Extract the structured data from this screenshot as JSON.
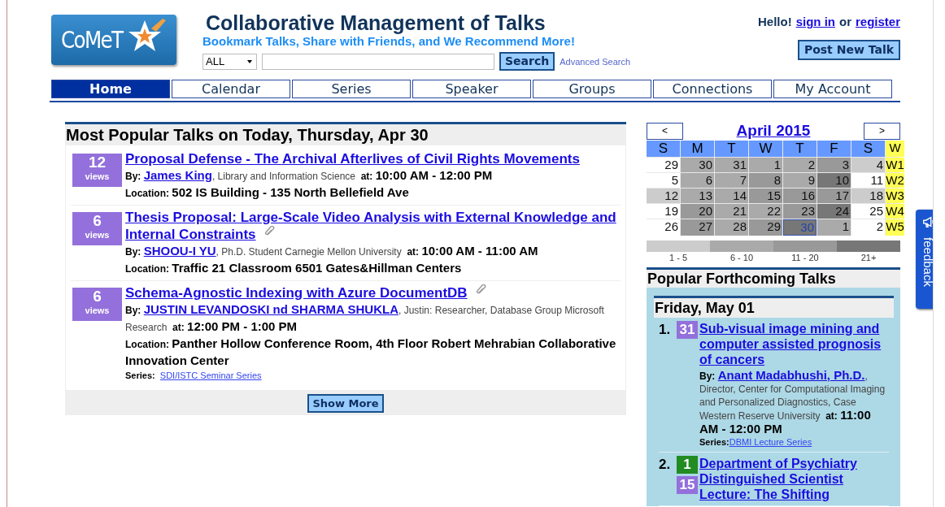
{
  "header": {
    "logo_text": "CoMeT",
    "title": "Collaborative Management of Talks",
    "tagline": "Bookmark Talks, Share with Friends, and We Recommend More!",
    "search": {
      "category": "ALL",
      "button": "Search"
    },
    "advanced_link": "Advanced Search",
    "greeting": "Hello!",
    "sign_in": "sign in",
    "or": "or",
    "register": "register",
    "post_button": "Post New Talk"
  },
  "nav": [
    {
      "label": "Home",
      "selected": true
    },
    {
      "label": "Calendar",
      "selected": false
    },
    {
      "label": "Series",
      "selected": false
    },
    {
      "label": "Speaker",
      "selected": false
    },
    {
      "label": "Groups",
      "selected": false
    },
    {
      "label": "Connections",
      "selected": false
    },
    {
      "label": "My Account",
      "selected": false
    }
  ],
  "popular": {
    "title": "Most Popular Talks on Today, Thursday, Apr 30",
    "talks": [
      {
        "views": "12",
        "views_label": "views",
        "title": "Proposal Defense - The Archival Afterlives of Civil Rights Movements",
        "attachment": false,
        "by_label": "By:",
        "speaker": "James King",
        "affiliation": ", Library and Information Science",
        "at_label": "at:",
        "time": "10:00 AM - 12:00 PM",
        "location_label": "Location:",
        "location": "502 IS Building - 135 North Bellefield Ave"
      },
      {
        "views": "6",
        "views_label": "views",
        "title": "Thesis Proposal: Large-Scale Video Analysis with External Knowledge and Internal Constraints",
        "attachment": true,
        "by_label": "By:",
        "speaker": "SHOOU-I YU",
        "affiliation": ", Ph.D. Student Carnegie Mellon University",
        "at_label": "at:",
        "time": "10:00 AM - 11:00 AM",
        "location_label": "Location:",
        "location": "Traffic 21 Classroom 6501  Gates&Hillman Centers"
      },
      {
        "views": "6",
        "views_label": "views",
        "title": "Schema-Agnostic Indexing with Azure DocumentDB",
        "attachment": true,
        "by_label": "By:",
        "speaker": "JUSTIN LEVANDOSKI nd SHARMA SHUKLA",
        "affiliation": ", Justin: Researcher, Database Group Microsoft Research",
        "at_label": "at:",
        "time": "12:00 PM - 1:00 PM",
        "location_label": "Location:",
        "location": "Panther Hollow Conference Room, 4th Floor  Robert Mehrabian Collaborative Innovation Center",
        "series_label": "Series:",
        "series": "SDI/ISTC Seminar Series"
      }
    ],
    "show_more": "Show More"
  },
  "calendar": {
    "prev": "<",
    "next": ">",
    "month": "April 2015",
    "weekdays": [
      "S",
      "M",
      "T",
      "W",
      "T",
      "F",
      "S"
    ],
    "week_header": "W",
    "weeks": [
      {
        "label": "W1",
        "days": [
          {
            "day": "29",
            "color": "#ffffff",
            "today": false
          },
          {
            "day": "30",
            "color": "#aaaaaa",
            "today": false
          },
          {
            "day": "31",
            "color": "#aaaaaa",
            "today": false
          },
          {
            "day": "1",
            "color": "#aaaaaa",
            "today": false
          },
          {
            "day": "2",
            "color": "#aaaaaa",
            "today": false
          },
          {
            "day": "3",
            "color": "#999999",
            "today": false
          },
          {
            "day": "4",
            "color": "#cccccc",
            "today": false
          }
        ]
      },
      {
        "label": "W2",
        "days": [
          {
            "day": "5",
            "color": "#ffffff",
            "today": false
          },
          {
            "day": "6",
            "color": "#aaaaaa",
            "today": false
          },
          {
            "day": "7",
            "color": "#aaaaaa",
            "today": false
          },
          {
            "day": "8",
            "color": "#999999",
            "today": false
          },
          {
            "day": "9",
            "color": "#aaaaaa",
            "today": false
          },
          {
            "day": "10",
            "color": "#777777",
            "today": false
          },
          {
            "day": "11",
            "color": "#ffffff",
            "today": false
          }
        ]
      },
      {
        "label": "W3",
        "days": [
          {
            "day": "12",
            "color": "#cccccc",
            "today": false
          },
          {
            "day": "13",
            "color": "#aaaaaa",
            "today": false
          },
          {
            "day": "14",
            "color": "#aaaaaa",
            "today": false
          },
          {
            "day": "15",
            "color": "#999999",
            "today": false
          },
          {
            "day": "16",
            "color": "#999999",
            "today": false
          },
          {
            "day": "17",
            "color": "#999999",
            "today": false
          },
          {
            "day": "18",
            "color": "#cccccc",
            "today": false
          }
        ]
      },
      {
        "label": "W4",
        "days": [
          {
            "day": "19",
            "color": "#ffffff",
            "today": false
          },
          {
            "day": "20",
            "color": "#999999",
            "today": false
          },
          {
            "day": "21",
            "color": "#aaaaaa",
            "today": false
          },
          {
            "day": "22",
            "color": "#aaaaaa",
            "today": false
          },
          {
            "day": "23",
            "color": "#999999",
            "today": false
          },
          {
            "day": "24",
            "color": "#777777",
            "today": false
          },
          {
            "day": "25",
            "color": "#ffffff",
            "today": false
          }
        ]
      },
      {
        "label": "W5",
        "days": [
          {
            "day": "26",
            "color": "#ffffff",
            "today": false
          },
          {
            "day": "27",
            "color": "#999999",
            "today": false
          },
          {
            "day": "28",
            "color": "#aaaaaa",
            "today": false
          },
          {
            "day": "29",
            "color": "#999999",
            "today": false
          },
          {
            "day": "30",
            "color": "#777777",
            "today": true
          },
          {
            "day": "1",
            "color": "#aaaaaa",
            "today": false
          },
          {
            "day": "2",
            "color": "#ffffff",
            "today": false
          }
        ]
      }
    ],
    "legend": [
      {
        "label": "1 - 5",
        "color": "#cccccc"
      },
      {
        "label": "6 - 10",
        "color": "#aaaaaa"
      },
      {
        "label": "11 - 20",
        "color": "#999999"
      },
      {
        "label": "21+",
        "color": "#777777"
      }
    ]
  },
  "forthcoming": {
    "title": "Popular Forthcoming Talks",
    "day_title": "Friday, May 01",
    "talks": [
      {
        "rank": "1.",
        "badges": [
          {
            "count": "31",
            "color": "#9370db"
          }
        ],
        "title": "Sub-visual image mining and computer assisted prognosis of cancers",
        "by_label": "By:",
        "speaker": "Anant Madabhushi, Ph.D.",
        "affiliation": ", Director, Center for Computational Imaging and Personalized Diagnostics, Case Western Reserve University",
        "at_label": "at:",
        "time": "11:00 AM - 12:00 PM",
        "series_label": "Series:",
        "series": "DBMI Lecture Series"
      },
      {
        "rank": "2.",
        "badges": [
          {
            "count": "1",
            "color": "#228b22"
          },
          {
            "count": "15",
            "color": "#9370db"
          }
        ],
        "title": "Department of Psychiatry Distinguished Scientist Lecture: The Shifting"
      }
    ]
  },
  "feedback": "feedback"
}
